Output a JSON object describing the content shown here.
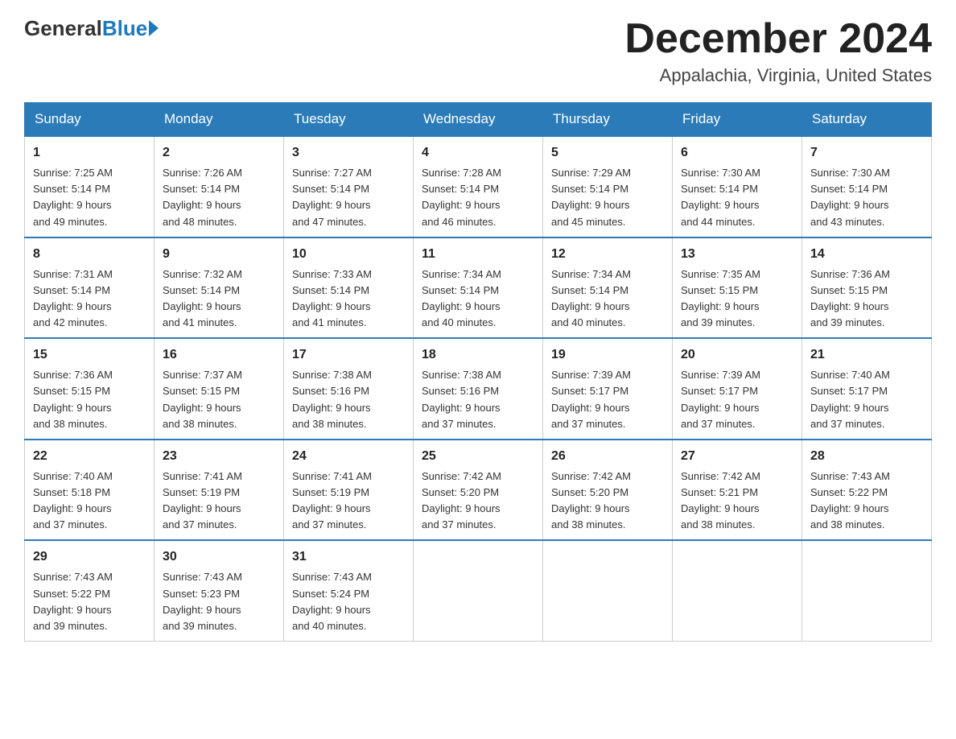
{
  "logo": {
    "general": "General",
    "blue": "Blue"
  },
  "title": {
    "month": "December 2024",
    "location": "Appalachia, Virginia, United States"
  },
  "headers": [
    "Sunday",
    "Monday",
    "Tuesday",
    "Wednesday",
    "Thursday",
    "Friday",
    "Saturday"
  ],
  "weeks": [
    [
      {
        "day": "1",
        "sunrise": "7:25 AM",
        "sunset": "5:14 PM",
        "daylight": "9 hours and 49 minutes."
      },
      {
        "day": "2",
        "sunrise": "7:26 AM",
        "sunset": "5:14 PM",
        "daylight": "9 hours and 48 minutes."
      },
      {
        "day": "3",
        "sunrise": "7:27 AM",
        "sunset": "5:14 PM",
        "daylight": "9 hours and 47 minutes."
      },
      {
        "day": "4",
        "sunrise": "7:28 AM",
        "sunset": "5:14 PM",
        "daylight": "9 hours and 46 minutes."
      },
      {
        "day": "5",
        "sunrise": "7:29 AM",
        "sunset": "5:14 PM",
        "daylight": "9 hours and 45 minutes."
      },
      {
        "day": "6",
        "sunrise": "7:30 AM",
        "sunset": "5:14 PM",
        "daylight": "9 hours and 44 minutes."
      },
      {
        "day": "7",
        "sunrise": "7:30 AM",
        "sunset": "5:14 PM",
        "daylight": "9 hours and 43 minutes."
      }
    ],
    [
      {
        "day": "8",
        "sunrise": "7:31 AM",
        "sunset": "5:14 PM",
        "daylight": "9 hours and 42 minutes."
      },
      {
        "day": "9",
        "sunrise": "7:32 AM",
        "sunset": "5:14 PM",
        "daylight": "9 hours and 41 minutes."
      },
      {
        "day": "10",
        "sunrise": "7:33 AM",
        "sunset": "5:14 PM",
        "daylight": "9 hours and 41 minutes."
      },
      {
        "day": "11",
        "sunrise": "7:34 AM",
        "sunset": "5:14 PM",
        "daylight": "9 hours and 40 minutes."
      },
      {
        "day": "12",
        "sunrise": "7:34 AM",
        "sunset": "5:14 PM",
        "daylight": "9 hours and 40 minutes."
      },
      {
        "day": "13",
        "sunrise": "7:35 AM",
        "sunset": "5:15 PM",
        "daylight": "9 hours and 39 minutes."
      },
      {
        "day": "14",
        "sunrise": "7:36 AM",
        "sunset": "5:15 PM",
        "daylight": "9 hours and 39 minutes."
      }
    ],
    [
      {
        "day": "15",
        "sunrise": "7:36 AM",
        "sunset": "5:15 PM",
        "daylight": "9 hours and 38 minutes."
      },
      {
        "day": "16",
        "sunrise": "7:37 AM",
        "sunset": "5:15 PM",
        "daylight": "9 hours and 38 minutes."
      },
      {
        "day": "17",
        "sunrise": "7:38 AM",
        "sunset": "5:16 PM",
        "daylight": "9 hours and 38 minutes."
      },
      {
        "day": "18",
        "sunrise": "7:38 AM",
        "sunset": "5:16 PM",
        "daylight": "9 hours and 37 minutes."
      },
      {
        "day": "19",
        "sunrise": "7:39 AM",
        "sunset": "5:17 PM",
        "daylight": "9 hours and 37 minutes."
      },
      {
        "day": "20",
        "sunrise": "7:39 AM",
        "sunset": "5:17 PM",
        "daylight": "9 hours and 37 minutes."
      },
      {
        "day": "21",
        "sunrise": "7:40 AM",
        "sunset": "5:17 PM",
        "daylight": "9 hours and 37 minutes."
      }
    ],
    [
      {
        "day": "22",
        "sunrise": "7:40 AM",
        "sunset": "5:18 PM",
        "daylight": "9 hours and 37 minutes."
      },
      {
        "day": "23",
        "sunrise": "7:41 AM",
        "sunset": "5:19 PM",
        "daylight": "9 hours and 37 minutes."
      },
      {
        "day": "24",
        "sunrise": "7:41 AM",
        "sunset": "5:19 PM",
        "daylight": "9 hours and 37 minutes."
      },
      {
        "day": "25",
        "sunrise": "7:42 AM",
        "sunset": "5:20 PM",
        "daylight": "9 hours and 37 minutes."
      },
      {
        "day": "26",
        "sunrise": "7:42 AM",
        "sunset": "5:20 PM",
        "daylight": "9 hours and 38 minutes."
      },
      {
        "day": "27",
        "sunrise": "7:42 AM",
        "sunset": "5:21 PM",
        "daylight": "9 hours and 38 minutes."
      },
      {
        "day": "28",
        "sunrise": "7:43 AM",
        "sunset": "5:22 PM",
        "daylight": "9 hours and 38 minutes."
      }
    ],
    [
      {
        "day": "29",
        "sunrise": "7:43 AM",
        "sunset": "5:22 PM",
        "daylight": "9 hours and 39 minutes."
      },
      {
        "day": "30",
        "sunrise": "7:43 AM",
        "sunset": "5:23 PM",
        "daylight": "9 hours and 39 minutes."
      },
      {
        "day": "31",
        "sunrise": "7:43 AM",
        "sunset": "5:24 PM",
        "daylight": "9 hours and 40 minutes."
      },
      null,
      null,
      null,
      null
    ]
  ],
  "labels": {
    "sunrise": "Sunrise:",
    "sunset": "Sunset:",
    "daylight": "Daylight:"
  }
}
